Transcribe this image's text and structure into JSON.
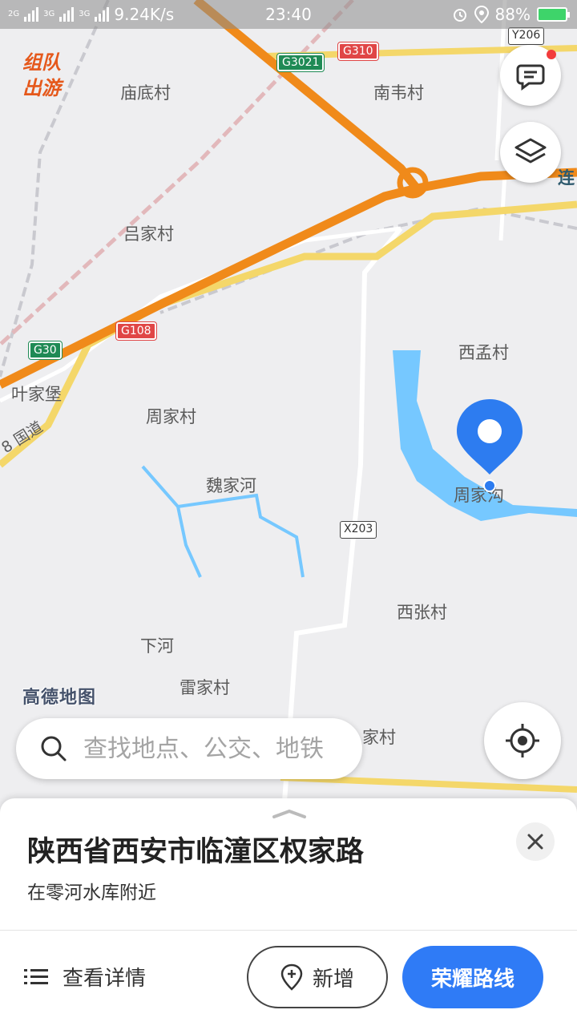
{
  "status_bar": {
    "net_labels": [
      "2G",
      "3G",
      "3G"
    ],
    "speed": "9.24K/s",
    "time": "23:40",
    "battery": "88%"
  },
  "promo": "组队出游",
  "map": {
    "places": {
      "miaodi": "庙底村",
      "nanwei": "南韦村",
      "lian": "连",
      "lvjia": "吕家村",
      "yejiabao": "叶家堡",
      "ximeng": "西孟村",
      "zhoujiacun": "周家村",
      "weijiahe": "魏家河",
      "zhoujiagou": "周家沟",
      "xizhang": "西张村",
      "xiahe": "下河",
      "leijia": "雷家村",
      "jiacun": "家村",
      "guodao": "8 国道"
    },
    "shields": {
      "g3021": "G3021",
      "g310": "G310",
      "g108": "G108",
      "g30": "G30",
      "x203": "X203",
      "y206": "Y206"
    },
    "logo": "高德地图"
  },
  "search": {
    "placeholder": "查找地点、公交、地铁"
  },
  "sheet": {
    "address": "陕西省西安市临潼区权家路",
    "subtitle": "在零河水库附近",
    "details_label": "查看详情",
    "add_label": "新增",
    "route_label": "荣耀路线"
  }
}
